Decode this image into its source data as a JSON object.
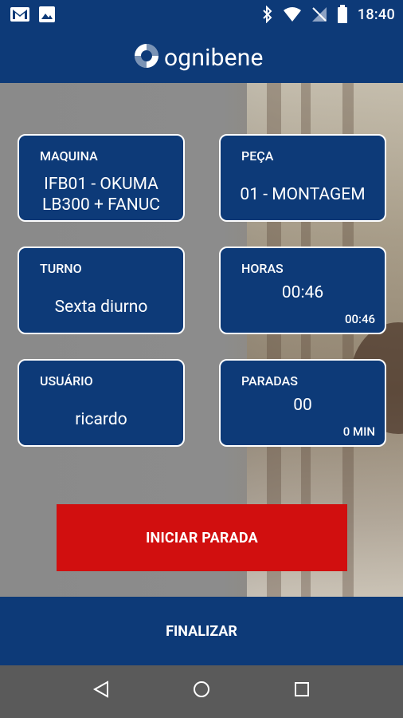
{
  "status_bar": {
    "time": "18:40",
    "left_icons": [
      "gmail-icon",
      "image-icon"
    ],
    "right_icons": [
      "bluetooth-icon",
      "wifi-icon",
      "no-signal-icon",
      "battery-icon"
    ]
  },
  "header": {
    "logo_text": "ognibene",
    "logo_icon": "ognibene-logo-icon"
  },
  "cards": {
    "maquina": {
      "label": "MAQUINA",
      "value": "IFB01 - OKUMA LB300 + FANUC"
    },
    "peca": {
      "label": "PEÇA",
      "value": "01 - MONTAGEM"
    },
    "turno": {
      "label": "TURNO",
      "value": "Sexta diurno"
    },
    "horas": {
      "label": "HORAS",
      "value": "00:46",
      "sub": "00:46"
    },
    "usuario": {
      "label": "USUÁRIO",
      "value": "ricardo"
    },
    "paradas": {
      "label": "PARADAS",
      "value": "00",
      "sub": "0 MIN"
    }
  },
  "actions": {
    "start_stop_label": "INICIAR PARADA",
    "finish_label": "FINALIZAR"
  },
  "nav": {
    "icons": [
      "back-icon",
      "home-icon",
      "recents-icon"
    ]
  },
  "colors": {
    "primary": "#0d3a78",
    "danger": "#d10f0f",
    "nav": "#5a5a5a"
  }
}
